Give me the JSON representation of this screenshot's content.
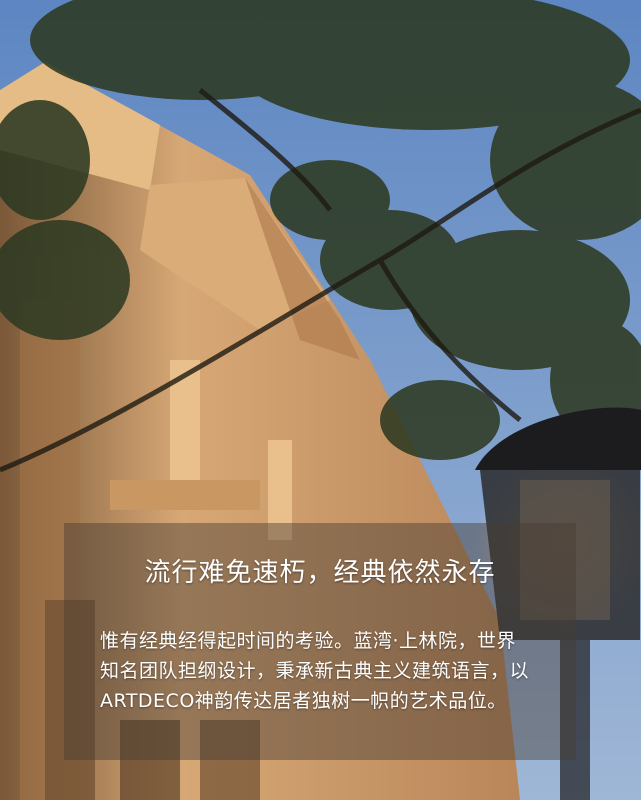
{
  "headline": "流行难免速朽，经典依然永存",
  "paragraph": {
    "lines": [
      "惟有经典经得起时间的考验。蓝湾·上林院，世界",
      "知名团队担纲设计，秉承新古典主义建筑语言，以",
      "ARTDECO神韵传达居者独树一帜的艺术品位。"
    ]
  },
  "colors": {
    "sky": "#6f8fb8",
    "stone": "#c99a66",
    "foliage": "#2d3a22",
    "text": "#ffffff"
  }
}
